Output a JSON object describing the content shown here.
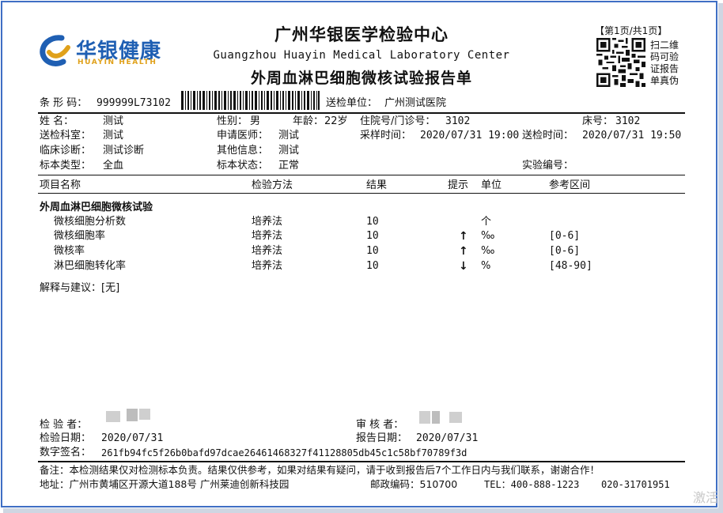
{
  "header": {
    "logo_cn": "华银健康",
    "logo_en": "HUAYIN HEALTH",
    "title_cn": "广州华银医学检验中心",
    "title_en": "Guangzhou Huayin Medical Laboratory Center",
    "report_title": "外周血淋巴细胞微核试验报告单",
    "page_no": "【第1页/共1页】",
    "qr_text": "扫二维码可验证报告单真伪"
  },
  "barcode_row": {
    "barcode_label": "条 形 码：",
    "barcode_value": "999999L73102",
    "unit_label": "送检单位：",
    "unit_value": "广州测试医院"
  },
  "patient": {
    "name_label": "姓    名：",
    "name_value": "测试",
    "sex_label": "性别：",
    "sex_value": "男",
    "age_label": "年龄：",
    "age_value": "22岁",
    "inpatient_label": "住院号/门诊号：",
    "inpatient_value": "3102",
    "bed_label": "床号：",
    "bed_value": "3102",
    "dept_label": "送检科室：",
    "dept_value": "测试",
    "doctor_label": "申请医师：",
    "doctor_value": "测试",
    "sample_time_label": "采样时间：",
    "sample_time_value": "2020/07/31 19:00",
    "send_time_label": "送检时间：",
    "send_time_value": "2020/07/31 19:50",
    "diagnosis_label": "临床诊断：",
    "diagnosis_value": "测试诊断",
    "other_label": "其他信息：",
    "other_value": "测试",
    "specimen_label": "标本类型：",
    "specimen_value": "全血",
    "specimen_status_label": "标本状态：",
    "specimen_status_value": "正常",
    "lab_no_label": "实验编号："
  },
  "table": {
    "headers": {
      "item": "项目名称",
      "method": "检验方法",
      "result": "结果",
      "hint": "提示",
      "unit": "单位",
      "ref": "参考区间"
    },
    "group_title": "外周血淋巴细胞微核试验",
    "rows": [
      {
        "item": "微核细胞分析数",
        "method": "培养法",
        "result": "10",
        "hint": "",
        "unit": "个",
        "ref": ""
      },
      {
        "item": "微核细胞率",
        "method": "培养法",
        "result": "10",
        "hint": "↑",
        "unit": "‰",
        "ref": "[0-6]"
      },
      {
        "item": "微核率",
        "method": "培养法",
        "result": "10",
        "hint": "↑",
        "unit": "‰",
        "ref": "[0-6]"
      },
      {
        "item": "淋巴细胞转化率",
        "method": "培养法",
        "result": "10",
        "hint": "↓",
        "unit": "%",
        "ref": "[48-90]"
      }
    ]
  },
  "advice": {
    "text": "解释与建议：[无]"
  },
  "signature": {
    "tester_label": "检 验 者：",
    "reviewer_label": "审 核 者：",
    "test_date_label": "检验日期：",
    "test_date_value": "2020/07/31",
    "report_date_label": "报告日期：",
    "report_date_value": "2020/07/31",
    "digital_sign_label": "数字签名：",
    "digital_sign_value": "261fb94fc5f26b0bafd97dcae26461468327f41128805db45c1c58bf70789f3d"
  },
  "footer": {
    "note": "备注：本检测结果仅对检测标本负责。结果仅供参考，如果对结果有疑问，请于收到报告后7个工作日内与我们联系，谢谢合作！",
    "address": "地址：广州市黄埔区开源大道188号   广州莱迪创新科技园",
    "postcode": "邮政编码：510700",
    "tel": "TEL：400-888-1223",
    "tel2": "020-31701951"
  },
  "watermark": "激活",
  "colors": {
    "border": "#3f6fc4",
    "logo_blue": "#1f5fb3",
    "logo_gold": "#e0a11b"
  }
}
